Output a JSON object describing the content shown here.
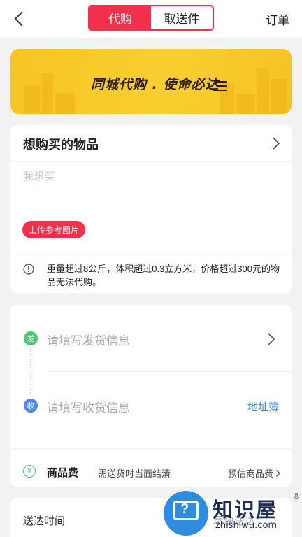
{
  "header": {
    "tabs": [
      {
        "label": "代购",
        "active": true
      },
      {
        "label": "取送件",
        "active": false
      }
    ],
    "orders_label": "订单",
    "back_icon": "chevron-left-icon"
  },
  "banner": {
    "slogan": "同城代购 . 使命必达"
  },
  "item_card": {
    "title": "想购买的物品",
    "input_placeholder": "我想买",
    "upload_label": "上传参考图片",
    "notice": "重量超过8公斤，体积超过0.3立方米，价格超过300元的物品无法代购。",
    "notice_icon": "info-circle-icon"
  },
  "address_card": {
    "send_badge": "发",
    "send_placeholder": "请填写发货信息",
    "receive_badge": "收",
    "receive_placeholder": "请填写收货信息",
    "address_book_label": "地址簿",
    "fee_icon": "¥",
    "fee_label": "商品费",
    "fee_note": "需送货时当面结清",
    "fee_estimate_label": "预估商品费"
  },
  "delivery_card": {
    "time_label": "送达时间",
    "time_value": "尽快送达"
  },
  "watermark": {
    "title": "知识屋",
    "registered": "®",
    "url": "zhishiwu.com",
    "mark": "?"
  },
  "colors": {
    "accent": "#f2304c",
    "banner_yellow": "#f8c72a",
    "send_green": "#4cc774",
    "receive_blue": "#4f86f1",
    "link_blue": "#3a86e6"
  }
}
